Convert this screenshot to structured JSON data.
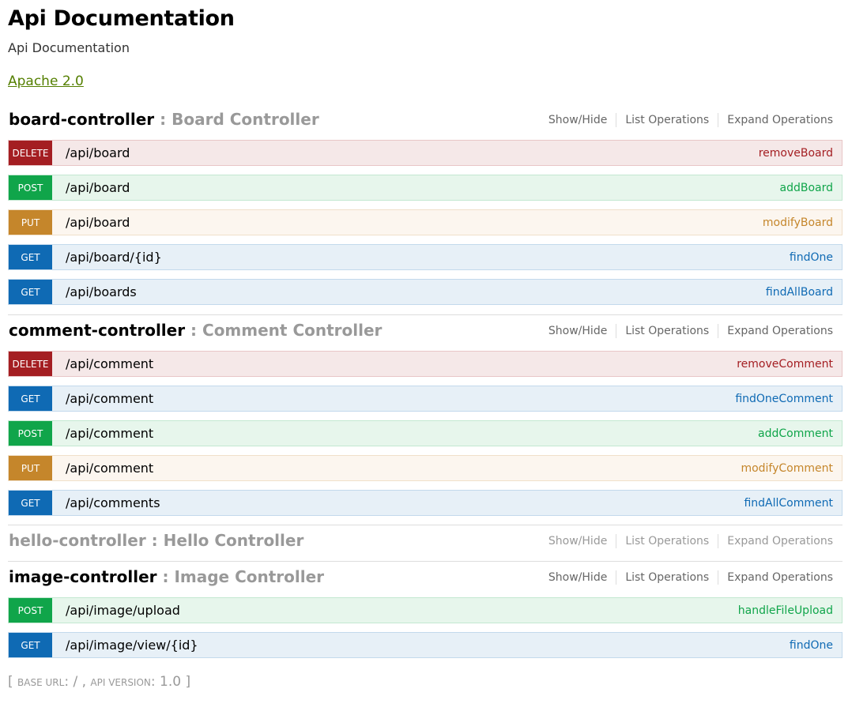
{
  "info": {
    "title": "Api Documentation",
    "description": "Api Documentation",
    "license": "Apache 2.0"
  },
  "ops_links": {
    "show_hide": "Show/Hide",
    "list": "List Operations",
    "expand": "Expand Operations"
  },
  "resources": [
    {
      "name": "board-controller",
      "separator": " : ",
      "description": "Board Controller",
      "operations": [
        {
          "method": "DELETE",
          "path": "/api/board",
          "nickname": "removeBoard"
        },
        {
          "method": "POST",
          "path": "/api/board",
          "nickname": "addBoard"
        },
        {
          "method": "PUT",
          "path": "/api/board",
          "nickname": "modifyBoard"
        },
        {
          "method": "GET",
          "path": "/api/board/{id}",
          "nickname": "findOne"
        },
        {
          "method": "GET",
          "path": "/api/boards",
          "nickname": "findAllBoard"
        }
      ]
    },
    {
      "name": "comment-controller",
      "separator": " : ",
      "description": "Comment Controller",
      "operations": [
        {
          "method": "DELETE",
          "path": "/api/comment",
          "nickname": "removeComment"
        },
        {
          "method": "GET",
          "path": "/api/comment",
          "nickname": "findOneComment"
        },
        {
          "method": "POST",
          "path": "/api/comment",
          "nickname": "addComment"
        },
        {
          "method": "PUT",
          "path": "/api/comment",
          "nickname": "modifyComment"
        },
        {
          "method": "GET",
          "path": "/api/comments",
          "nickname": "findAllComment"
        }
      ]
    },
    {
      "name": "hello-controller",
      "separator": " : ",
      "description": "Hello Controller",
      "operations": []
    },
    {
      "name": "image-controller",
      "separator": " : ",
      "description": "Image Controller",
      "operations": [
        {
          "method": "POST",
          "path": "/api/image/upload",
          "nickname": "handleFileUpload"
        },
        {
          "method": "GET",
          "path": "/api/image/view/{id}",
          "nickname": "findOne"
        }
      ]
    }
  ],
  "footer": {
    "open": "[ ",
    "base_url_label": "Base url",
    "base_url_value": ": / , ",
    "api_version_label": "api version",
    "api_version_value": ": 1.0",
    "close": " ]"
  }
}
